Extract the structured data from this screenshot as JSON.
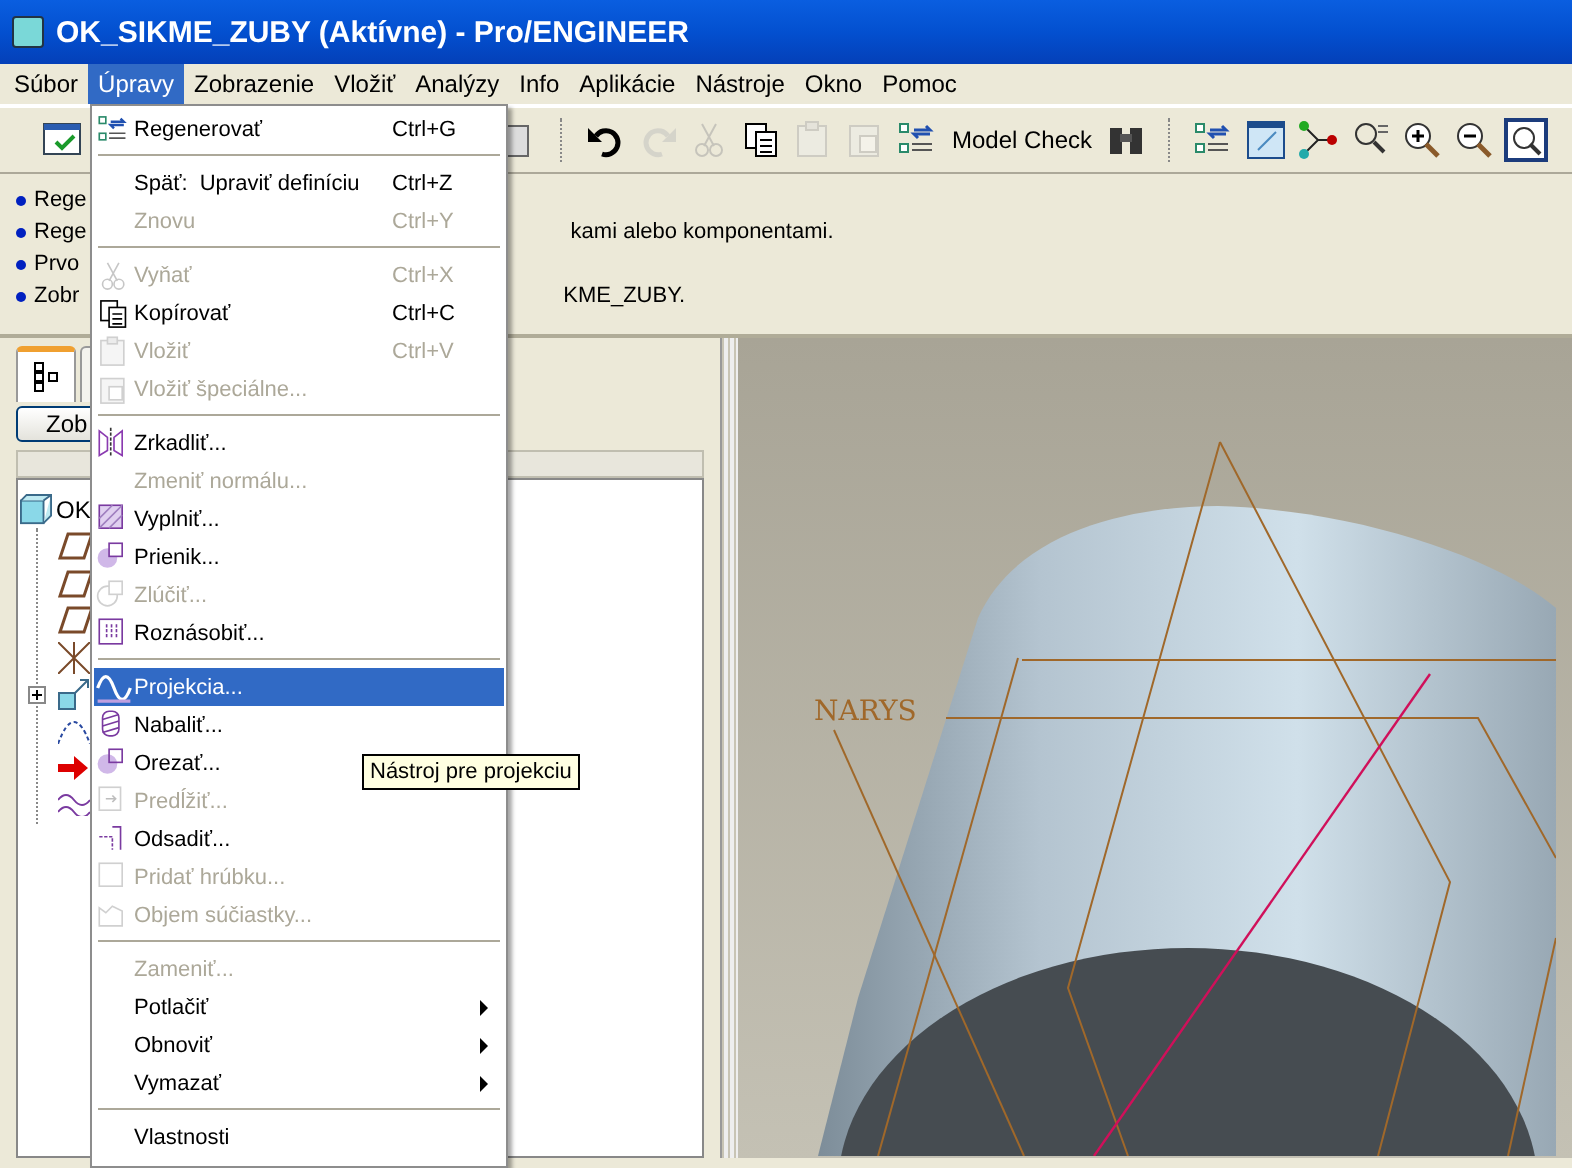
{
  "window": {
    "title": "OK_SIKME_ZUBY (Aktívne) - Pro/ENGINEER"
  },
  "menubar": [
    {
      "label": "Súbor",
      "selected": false
    },
    {
      "label": "Úpravy",
      "selected": true
    },
    {
      "label": "Zobrazenie",
      "selected": false
    },
    {
      "label": "Vložiť",
      "selected": false
    },
    {
      "label": "Analýzy",
      "selected": false
    },
    {
      "label": "Info",
      "selected": false
    },
    {
      "label": "Aplikácie",
      "selected": false
    },
    {
      "label": "Nástroje",
      "selected": false
    },
    {
      "label": "Okno",
      "selected": false
    },
    {
      "label": "Pomoc",
      "selected": false
    }
  ],
  "toolbar": [
    {
      "kind": "icon",
      "disabled": false
    },
    {
      "kind": "gap"
    },
    {
      "kind": "icon",
      "disabled": false
    },
    {
      "kind": "sep"
    },
    {
      "kind": "icon",
      "disabled": false
    },
    {
      "kind": "icon",
      "disabled": true
    },
    {
      "kind": "icon",
      "disabled": true
    },
    {
      "kind": "icon",
      "disabled": false
    },
    {
      "kind": "icon",
      "disabled": true
    },
    {
      "kind": "icon",
      "disabled": true
    },
    {
      "kind": "icon",
      "disabled": false
    },
    {
      "kind": "text",
      "label": "Model Check"
    },
    {
      "kind": "icon",
      "disabled": false
    },
    {
      "kind": "sep"
    },
    {
      "kind": "icon",
      "disabled": false
    },
    {
      "kind": "icon",
      "disabled": false
    },
    {
      "kind": "icon",
      "disabled": false
    },
    {
      "kind": "icon",
      "disabled": false
    },
    {
      "kind": "icon",
      "disabled": false
    },
    {
      "kind": "icon",
      "disabled": false
    },
    {
      "kind": "icon",
      "disabled": false
    }
  ],
  "messages": [
    {
      "start": "Rege"
    },
    {
      "start": "Rege",
      "end": "kami alebo komponentami."
    },
    {
      "start": "Prvo"
    },
    {
      "start": "Zobr",
      "end": "KME_ZUBY."
    }
  ],
  "left_panel": {
    "button": "Zob",
    "tabs": [
      {
        "selected": true
      },
      {
        "selected": false
      }
    ],
    "tree": {
      "label": "OK",
      "feature_expanded": false
    }
  },
  "edit_menu": [
    {
      "kind": "item",
      "label": "Regenerovať",
      "shortcut": "Ctrl+G",
      "disabled": false,
      "selected": false
    },
    {
      "kind": "separator"
    },
    {
      "kind": "item",
      "label": "Späť:  Upraviť definíciu",
      "shortcut": "Ctrl+Z",
      "disabled": false,
      "selected": false
    },
    {
      "kind": "item",
      "label": "Znovu",
      "shortcut": "Ctrl+Y",
      "disabled": true,
      "selected": false
    },
    {
      "kind": "separator"
    },
    {
      "kind": "item",
      "label": "Vyňať",
      "shortcut": "Ctrl+X",
      "disabled": true,
      "selected": false
    },
    {
      "kind": "item",
      "label": "Kopírovať",
      "shortcut": "Ctrl+C",
      "disabled": false,
      "selected": false
    },
    {
      "kind": "item",
      "label": "Vložiť",
      "shortcut": "Ctrl+V",
      "disabled": true,
      "selected": false
    },
    {
      "kind": "item",
      "label": "Vložiť špeciálne...",
      "disabled": true,
      "selected": false
    },
    {
      "kind": "separator"
    },
    {
      "kind": "item",
      "label": "Zrkadliť...",
      "disabled": false,
      "selected": false
    },
    {
      "kind": "item",
      "label": "Zmeniť normálu...",
      "disabled": true,
      "selected": false
    },
    {
      "kind": "item",
      "label": "Vyplniť...",
      "disabled": false,
      "selected": false
    },
    {
      "kind": "item",
      "label": "Prienik...",
      "disabled": false,
      "selected": false
    },
    {
      "kind": "item",
      "label": "Zlúčiť...",
      "disabled": true,
      "selected": false
    },
    {
      "kind": "item",
      "label": "Roznásobiť...",
      "disabled": false,
      "selected": false
    },
    {
      "kind": "separator"
    },
    {
      "kind": "item",
      "label": "Projekcia...",
      "disabled": false,
      "selected": true
    },
    {
      "kind": "item",
      "label": "Nabaliť...",
      "disabled": false,
      "selected": false
    },
    {
      "kind": "item",
      "label": "Orezať...",
      "disabled": false,
      "selected": false
    },
    {
      "kind": "item",
      "label": "Predĺžiť...",
      "disabled": true,
      "selected": false
    },
    {
      "kind": "item",
      "label": "Odsadiť...",
      "disabled": false,
      "selected": false
    },
    {
      "kind": "item",
      "label": "Pridať hrúbku...",
      "disabled": true,
      "selected": false
    },
    {
      "kind": "item",
      "label": "Objem súčiastky...",
      "disabled": true,
      "selected": false
    },
    {
      "kind": "separator"
    },
    {
      "kind": "item",
      "label": "Zameniť...",
      "disabled": true,
      "selected": false
    },
    {
      "kind": "item",
      "label": "Potlačiť",
      "submenu": true,
      "disabled": false,
      "selected": false
    },
    {
      "kind": "item",
      "label": "Obnoviť",
      "submenu": true,
      "disabled": false,
      "selected": false
    },
    {
      "kind": "item",
      "label": "Vymazať",
      "submenu": true,
      "disabled": false,
      "selected": false
    },
    {
      "kind": "separator"
    },
    {
      "kind": "item",
      "label": "Vlastnosti",
      "disabled": false,
      "selected": false
    }
  ],
  "tooltip": "Nástroj pre projekciu",
  "viewport": {
    "label": "NARYS"
  }
}
